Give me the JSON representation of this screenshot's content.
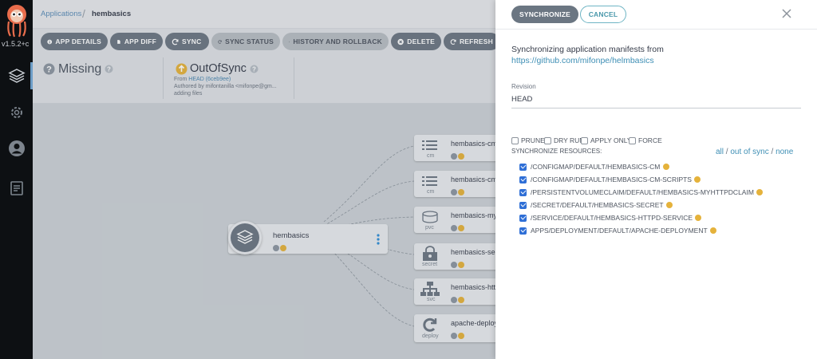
{
  "app": {
    "version": "v1.5.2+c"
  },
  "breadcrumb": {
    "root": "Applications",
    "separator": "/",
    "current": "hembasics"
  },
  "toolbar": {
    "app_details": "APP DETAILS",
    "app_diff": "APP DIFF",
    "sync": "SYNC",
    "sync_status": "SYNC STATUS",
    "history": "HISTORY AND ROLLBACK",
    "delete": "DELETE",
    "refresh": "REFRESH"
  },
  "status": {
    "health": "Missing",
    "sync": "OutOfSync",
    "from_prefix": "From",
    "from_ref": "HEAD (6ceb9ee)",
    "author": "Authored by mifontanilla <mifonpe@gm...",
    "message": "adding files"
  },
  "graph": {
    "root": {
      "name": "hembasics"
    },
    "nodes": [
      {
        "name": "hembasics-cm",
        "kind": "cm",
        "icon": "list-icon"
      },
      {
        "name": "hembasics-cm-",
        "kind": "cm",
        "icon": "list-icon"
      },
      {
        "name": "hembasics-myh",
        "kind": "pvc",
        "icon": "database-icon"
      },
      {
        "name": "hembasics-sec",
        "kind": "secret",
        "icon": "lock-icon"
      },
      {
        "name": "hembasics-http",
        "kind": "svc",
        "icon": "network-icon"
      },
      {
        "name": "apache-deploy",
        "kind": "deploy",
        "icon": "refresh-icon"
      }
    ]
  },
  "panel": {
    "synchronize_label": "SYNCHRONIZE",
    "cancel_label": "CANCEL",
    "intro": "Synchronizing application manifests from",
    "repo_url": "https://github.com/mifonpe/helmbasics",
    "revision_label": "Revision",
    "revision_value": "HEAD",
    "options": {
      "prune": "PRUNE",
      "dry_run": "DRY RUN",
      "apply_only": "APPLY ONLY",
      "force": "FORCE"
    },
    "resources_label": "SYNCHRONIZE RESOURCES:",
    "select": {
      "all": "all",
      "sep1": " / ",
      "out_of_sync": "out of sync",
      "sep2": " / ",
      "none": "none"
    },
    "resources": [
      "/CONFIGMAP/DEFAULT/HEMBASICS-CM",
      "/CONFIGMAP/DEFAULT/HEMBASICS-CM-SCRIPTS",
      "/PERSISTENTVOLUMECLAIM/DEFAULT/HEMBASICS-MYHTTPDCLAIM",
      "/SECRET/DEFAULT/HEMBASICS-SECRET",
      "/SERVICE/DEFAULT/HEMBASICS-HTTPD-SERVICE",
      "APPS/DEPLOYMENT/DEFAULT/APACHE-DEPLOYMENT"
    ]
  }
}
